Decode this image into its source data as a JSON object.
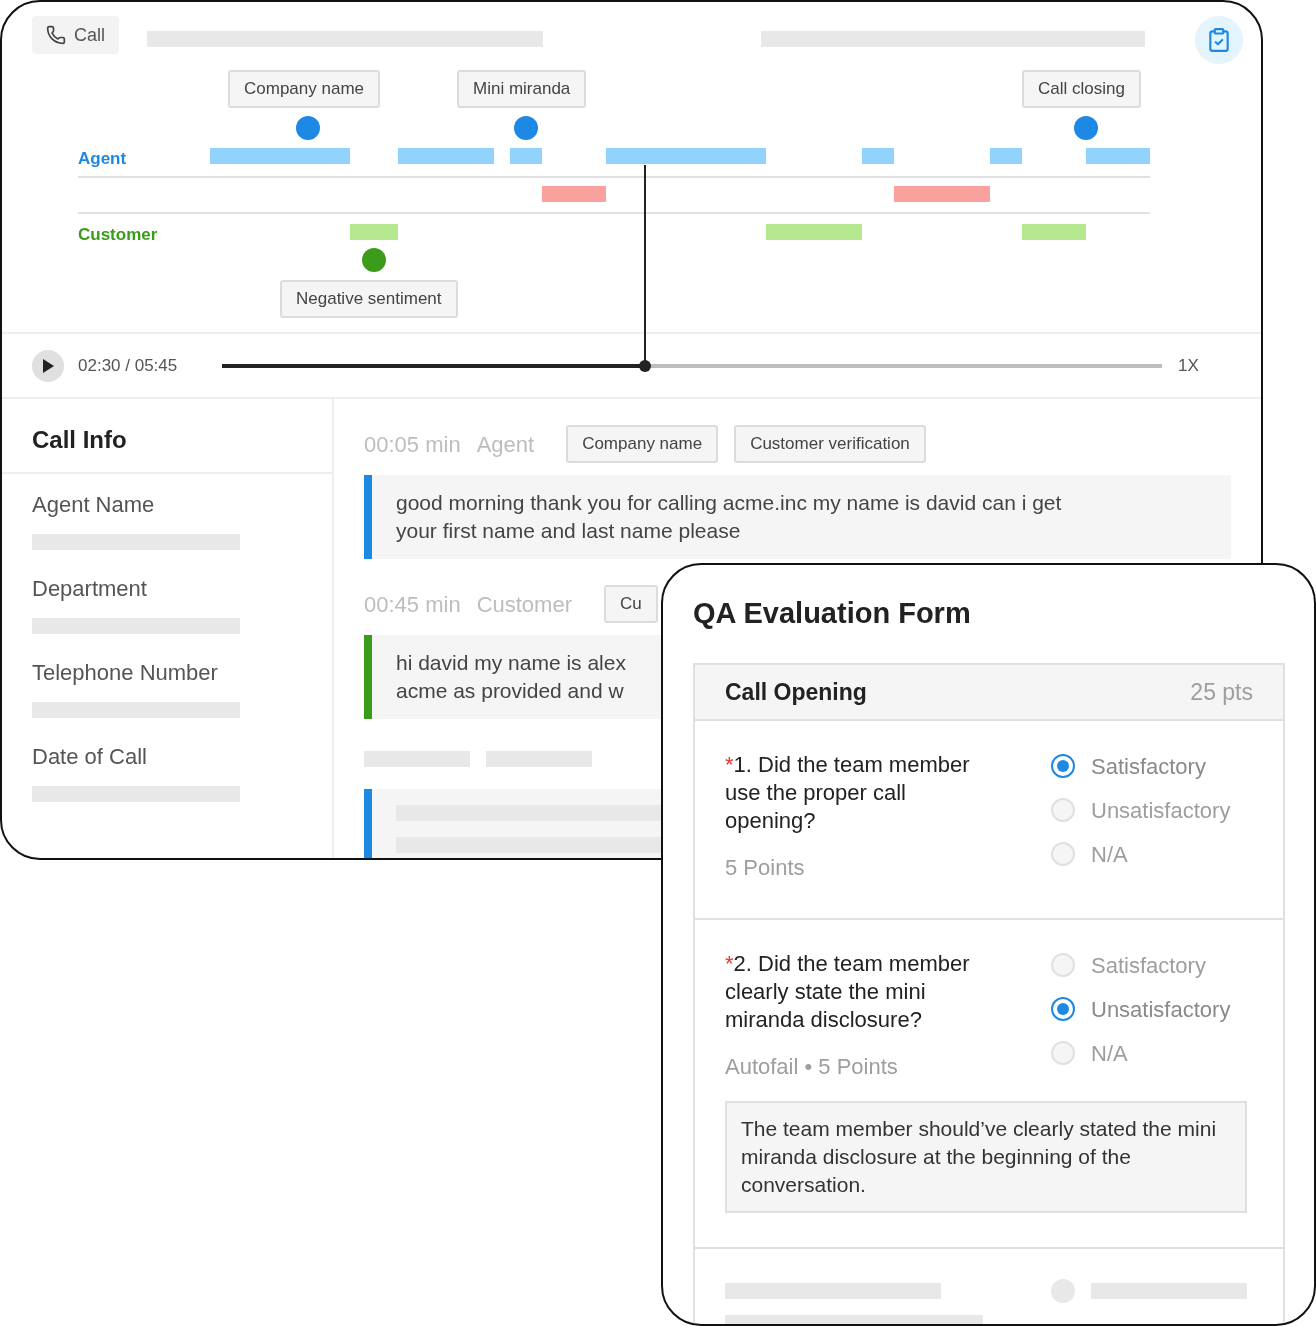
{
  "header": {
    "call_button": "Call"
  },
  "timeline": {
    "speakers": [
      {
        "label": "Agent",
        "color": "#1e88e5"
      },
      {
        "label": "Customer",
        "color": "#3a9c1a"
      }
    ],
    "agent_tags": [
      "Company name",
      "Mini miranda",
      "Call closing"
    ],
    "customer_tags": [
      "Negative sentiment"
    ]
  },
  "player": {
    "time": "02:30 / 05:45",
    "level": 0.45,
    "speed": "1X"
  },
  "call_info": {
    "title": "Call Info",
    "fields": [
      "Agent Name",
      "Department",
      "Telephone Number",
      "Date of Call"
    ]
  },
  "transcript": [
    {
      "time": "00:05 min",
      "speaker": "Agent",
      "color": "#1e88e5",
      "tags": [
        "Company name",
        "Customer verification"
      ],
      "lines": [
        "good morning thank you for calling acme.inc my name is david can i get",
        "your first name and last name please"
      ]
    },
    {
      "time": "00:45 min",
      "speaker": "Customer",
      "color": "#3a9c1a",
      "tags": [
        "Cu"
      ],
      "lines": [
        "hi david my name is alex",
        "acme as provided and w"
      ]
    }
  ],
  "qa_form": {
    "title": "QA Evaluation Form",
    "section": {
      "title": "Call Opening",
      "points": "25 pts"
    },
    "questions": [
      {
        "marker": "*",
        "text": "1. Did the team member use the proper call opening?",
        "points": "5 Points",
        "options": [
          {
            "label": "Satisfactory",
            "selected": true
          },
          {
            "label": "Unsatisfactory",
            "selected": false
          },
          {
            "label": "N/A",
            "selected": false
          }
        ]
      },
      {
        "marker": "*",
        "text": "2. Did the team member clearly state the mini miranda disclosure?",
        "points": "Autofail • 5 Points",
        "options": [
          {
            "label": "Satisfactory",
            "selected": false
          },
          {
            "label": "Unsatisfactory",
            "selected": true
          },
          {
            "label": "N/A",
            "selected": false
          }
        ],
        "comment": "The team member should’ve clearly stated the mini miranda disclosure at the beginning of the conversation."
      }
    ]
  }
}
